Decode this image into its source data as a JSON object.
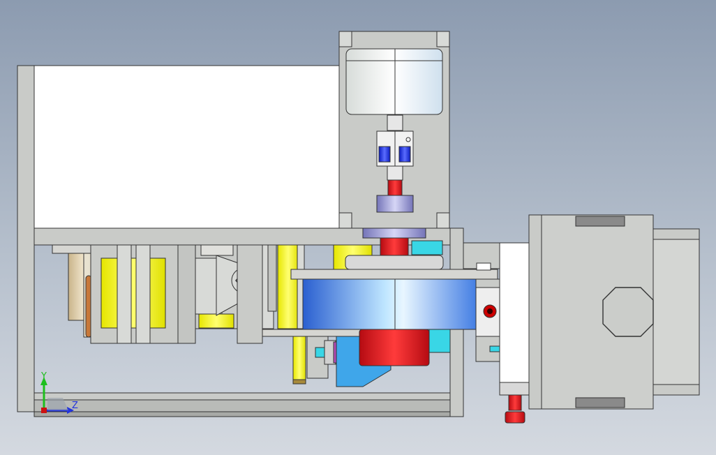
{
  "colors": {
    "background_top": "#8c9bb0",
    "background_bottom": "#d4d9e0",
    "frame_gray": "#c9cbc8",
    "panel_white": "#ffffff",
    "motor_body": "#dfe2e3",
    "coupling_blue": "#1f2fd6",
    "shaft_red": "#e0141c",
    "wheel_blue": "#5aa4ee",
    "yellow_part": "#ffff33",
    "cyan_part": "#39d6e6",
    "copper_rod": "#c8783a",
    "axis_y": "#1dbf1d",
    "axis_z": "#2233dd",
    "axis_origin": "#cc1111"
  },
  "axes": {
    "y_label": "Y",
    "z_label": "Z"
  },
  "icons": {
    "triad": "coordinate-triad-icon",
    "hex_bolt": "hex-bolt-icon",
    "octagon_window": "octagon-flange-icon"
  }
}
